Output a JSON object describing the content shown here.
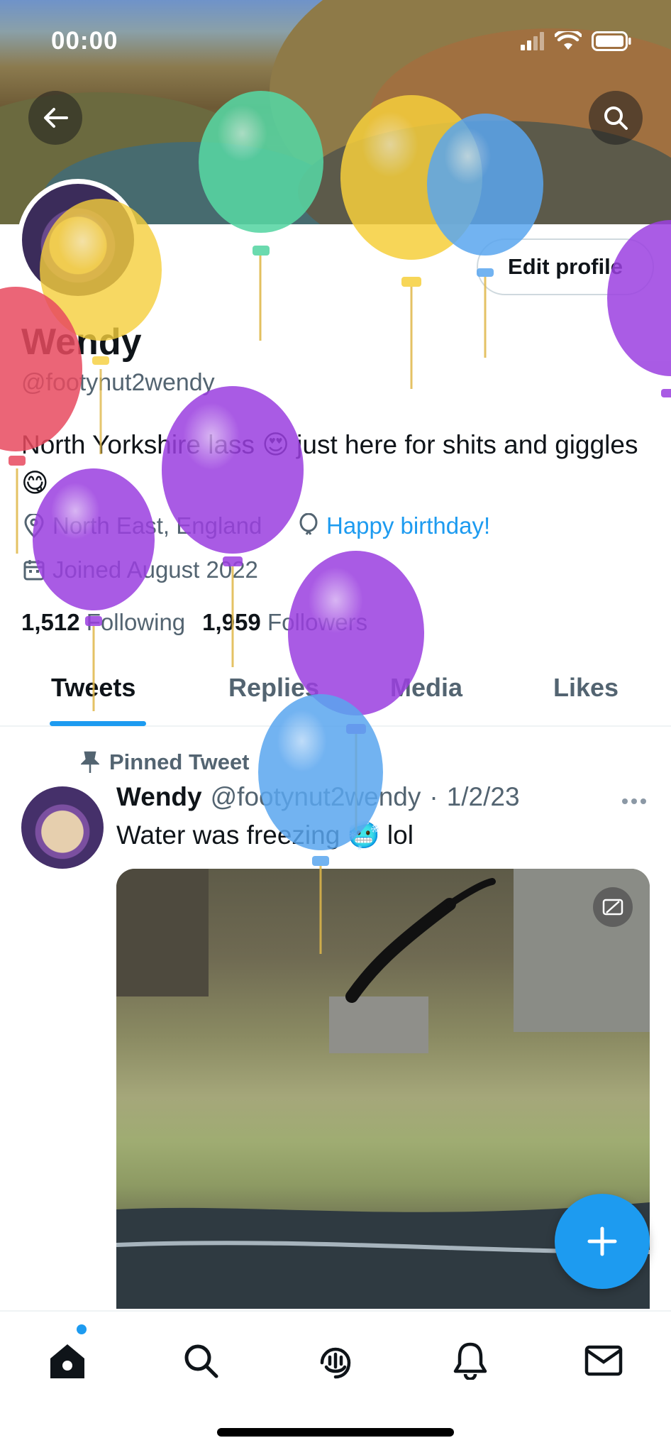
{
  "status_bar": {
    "time": "00:00"
  },
  "header": {
    "back_icon": "arrow-left-icon",
    "search_icon": "search-icon"
  },
  "profile": {
    "display_name": "Wendy",
    "handle": "@footynut2wendy",
    "bio": "North Yorkshire lass 😍 just here for shits and giggles 😋",
    "location": "North East, England",
    "birthday": "Happy birthday!",
    "joined": "Joined August 2022",
    "following_count": "1,512",
    "following_label": "Following",
    "followers_count": "1,959",
    "followers_label": "Followers",
    "edit_profile_label": "Edit profile"
  },
  "tabs": [
    {
      "label": "Tweets",
      "active": true
    },
    {
      "label": "Replies",
      "active": false
    },
    {
      "label": "Media",
      "active": false
    },
    {
      "label": "Likes",
      "active": false
    }
  ],
  "pinned_tweet": {
    "pinned_label": "Pinned Tweet",
    "author_name": "Wendy",
    "author_handle": "@footynut2wendy",
    "separator": "·",
    "date": "1/2/23",
    "text": "Water was freezing 🥶 lol",
    "more_icon": "ellipsis-icon",
    "media_badge_icon": "captions-icon"
  },
  "bottom_nav": [
    {
      "name": "home",
      "icon": "home-icon",
      "active": true,
      "has_dot": true
    },
    {
      "name": "search",
      "icon": "search-icon"
    },
    {
      "name": "spaces",
      "icon": "spaces-icon"
    },
    {
      "name": "notifications",
      "icon": "bell-icon"
    },
    {
      "name": "messages",
      "icon": "mail-icon"
    }
  ],
  "colors": {
    "accent": "#1d9bf0",
    "text_primary": "#0f1419",
    "text_secondary": "#536471",
    "balloon_green": "#57d6a3",
    "balloon_yellow": "#f6cf3c",
    "balloon_blue": "#5aa6ef",
    "balloon_purple": "#9b3fe0",
    "balloon_red": "#e84a5f"
  }
}
